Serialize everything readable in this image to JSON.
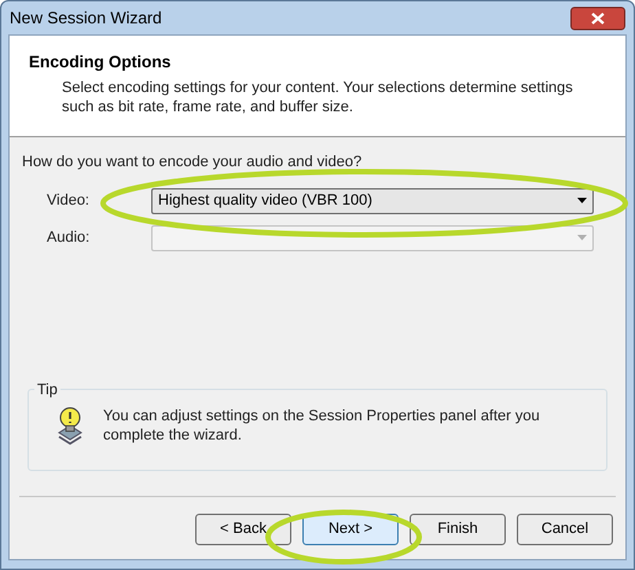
{
  "window": {
    "title": "New Session Wizard"
  },
  "header": {
    "title": "Encoding Options",
    "description": "Select encoding settings for your content. Your selections determine settings such as bit rate, frame rate, and buffer size."
  },
  "question": "How do you want to encode your audio and video?",
  "fields": [
    {
      "label": "Video:",
      "value": "Highest quality video (VBR 100)",
      "disabled": false
    },
    {
      "label": "Audio:",
      "disabled": true
    }
  ],
  "tip": {
    "title": "Tip",
    "text": "You can adjust settings on the Session Properties panel after you complete the wizard."
  },
  "buttons": [
    {
      "label": "< Back",
      "focused": false
    },
    {
      "label": "Next >",
      "focused": true
    },
    {
      "label": "Finish",
      "focused": false
    },
    {
      "label": "Cancel",
      "focused": false
    }
  ]
}
